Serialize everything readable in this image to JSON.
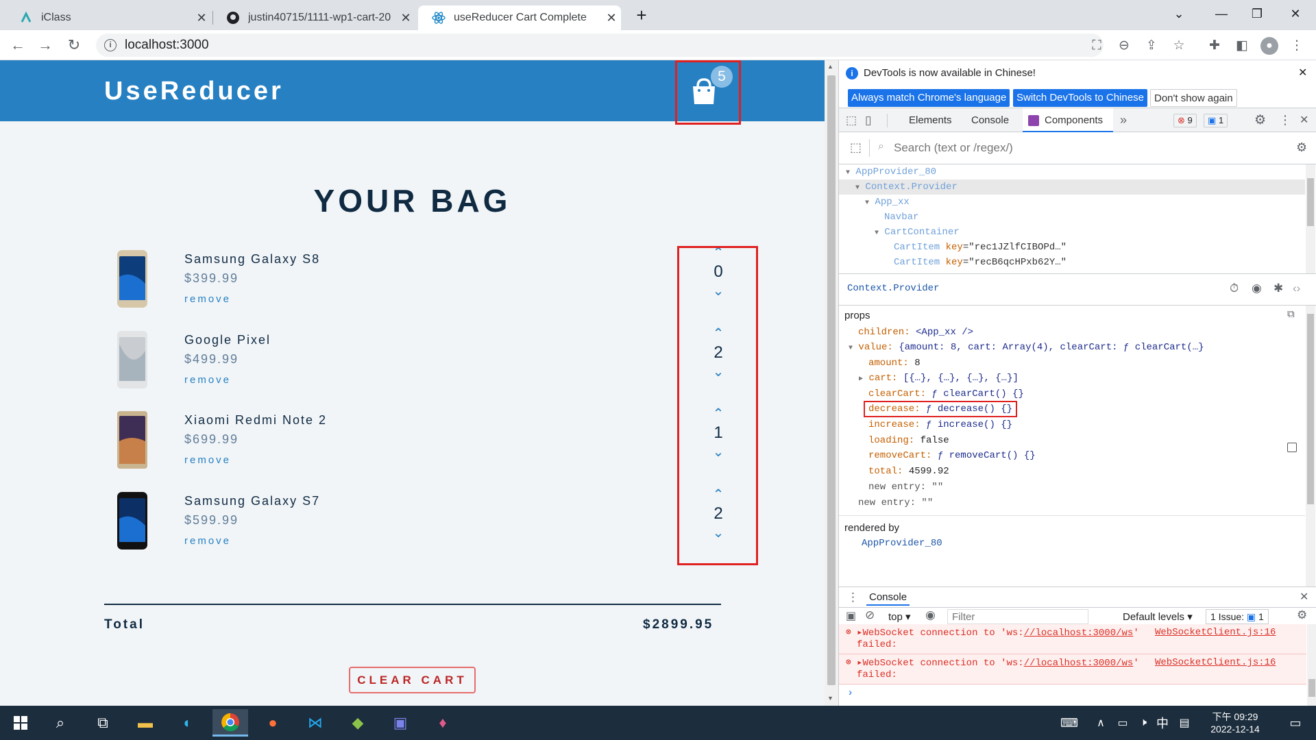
{
  "browser": {
    "tabs": [
      {
        "title": "iClass",
        "icon": "iclass-icon"
      },
      {
        "title": "justin40715/1111-wp1-cart-20",
        "icon": "github-icon"
      },
      {
        "title": "useReducer Cart Complete",
        "icon": "react-icon",
        "active": true
      }
    ],
    "new_tab": "+",
    "url": "localhost:3000"
  },
  "app": {
    "brand": "UseReducer",
    "cart_count": "5",
    "bag_title": "YOUR BAG",
    "items": [
      {
        "name": "Samsung Galaxy S8",
        "price": "$399.99",
        "remove": "remove",
        "amount": "0"
      },
      {
        "name": "Google Pixel",
        "price": "$499.99",
        "remove": "remove",
        "amount": "2"
      },
      {
        "name": "Xiaomi Redmi Note 2",
        "price": "$699.99",
        "remove": "remove",
        "amount": "1"
      },
      {
        "name": "Samsung Galaxy S7",
        "price": "$599.99",
        "remove": "remove",
        "amount": "2"
      }
    ],
    "total_label": "Total",
    "total_value": "$2899.95",
    "clear_button": "CLEAR CART"
  },
  "devtools": {
    "notice": "DevTools is now available in Chinese!",
    "btn_match": "Always match Chrome's language",
    "btn_switch": "Switch DevTools to Chinese",
    "btn_dont": "Don't show again",
    "tabs": {
      "elements": "Elements",
      "console": "Console",
      "components": "Components",
      "more": "»"
    },
    "error_count": "9",
    "msg_count": "1",
    "search_placeholder": "Search (text or /regex/)",
    "tree": {
      "n1": "AppProvider_80",
      "n2": "Context.Provider",
      "n3": "App_xx",
      "n4": "Navbar",
      "n5": "CartContainer",
      "n6_name": "CartItem",
      "n6_key": "key",
      "n6_val": "=\"rec1JZlfCIBOPd…\"",
      "n7_name": "CartItem",
      "n7_key": "key",
      "n7_val": "=\"recB6qcHPxb62Y…\""
    },
    "selected": "Context.Provider",
    "props_title": "props",
    "props": {
      "children_k": "children:",
      "children_v": "<App_xx />",
      "value_k": "value:",
      "value_v": "{amount: 8, cart: Array(4), clearCart: ƒ clearCart(…}",
      "amount_k": "amount:",
      "amount_v": "8",
      "cart_k": "cart:",
      "cart_v": "[{…}, {…}, {…}, {…}]",
      "clearCart_k": "clearCart:",
      "clearCart_v": "ƒ clearCart() {}",
      "decrease_k": "decrease:",
      "decrease_v": "ƒ decrease() {}",
      "increase_k": "increase:",
      "increase_v": "ƒ increase() {}",
      "loading_k": "loading:",
      "loading_v": "false",
      "removeCart_k": "removeCart:",
      "removeCart_v": "ƒ removeCart() {}",
      "total_k": "total:",
      "total_v": "4599.92",
      "newentry_k": "new entry:",
      "newentry_v": "\"\""
    },
    "rendered_by": "rendered by",
    "rendered_by_v": "AppProvider_80",
    "console": {
      "tab": "Console",
      "context": "top",
      "filter_placeholder": "Filter",
      "levels": "Default levels",
      "issues": "1 Issue:",
      "issues_count": "1",
      "err1_a": "WebSocket connection to 'ws:",
      "err1_link": "//localhost:3000/ws",
      "err1_b": "'",
      "err1_src": "WebSocketClient.js:16",
      "err1_c": "failed:",
      "err2_a": "WebSocket connection to 'ws:",
      "err2_link": "//localhost:3000/ws",
      "err2_b": "'",
      "err2_src": "WebSocketClient.js:16",
      "err2_c": "failed:"
    }
  },
  "taskbar": {
    "time_prefix": "下午",
    "time": "09:29",
    "date": "2022-12-14",
    "ime": "中"
  }
}
